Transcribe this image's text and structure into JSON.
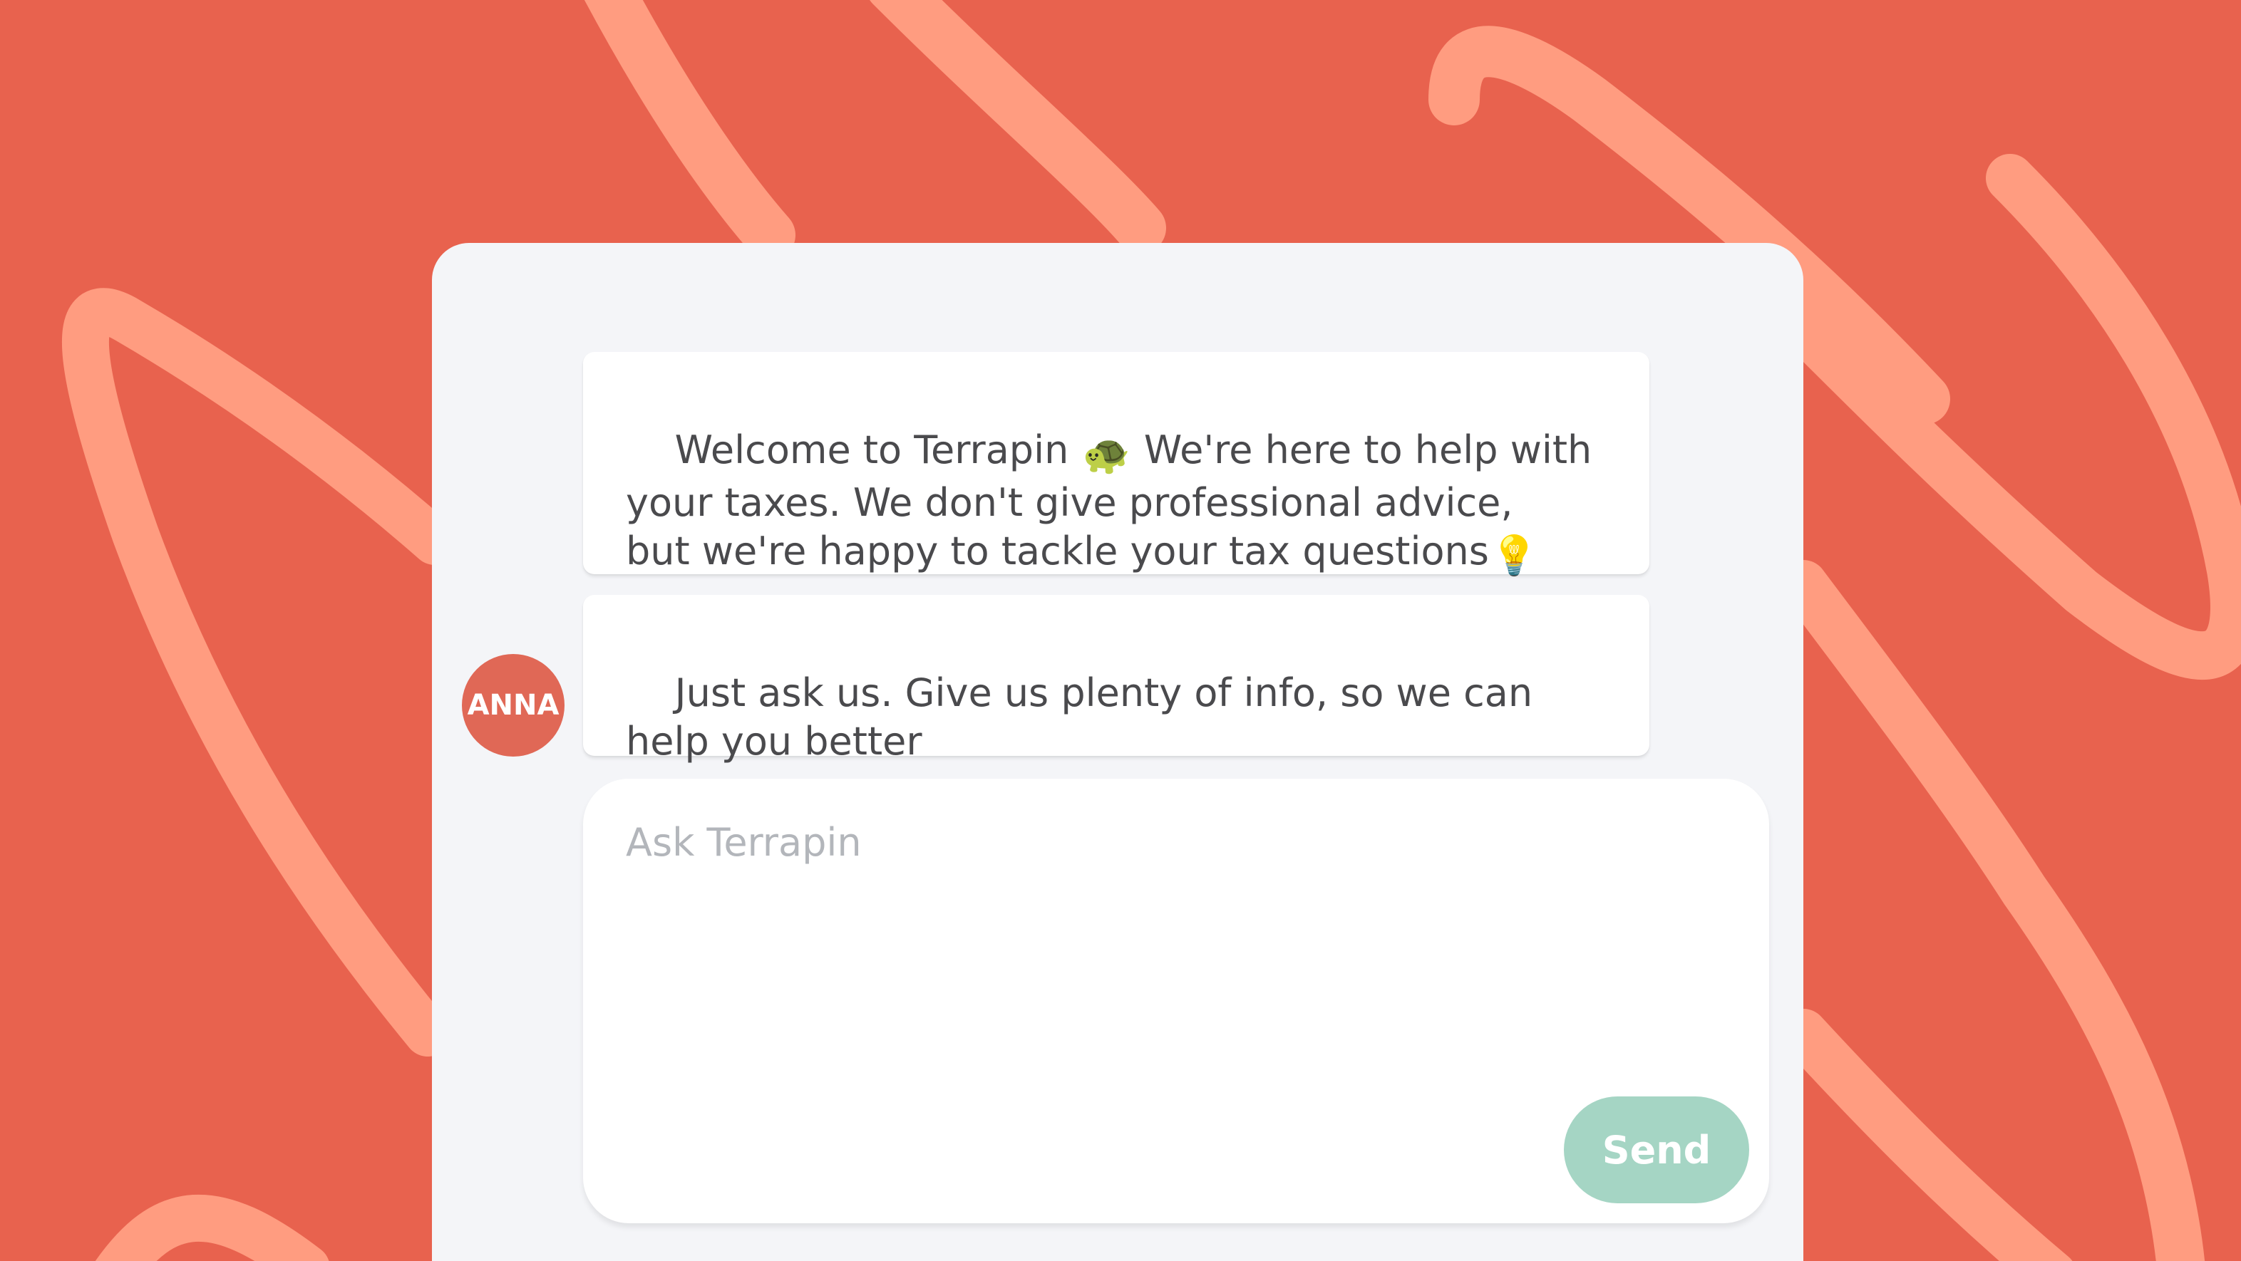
{
  "chat": {
    "messages": [
      {
        "line1_a": "Welcome to Terrapin ",
        "line1_emoji": "🐢",
        "line1_b": " We're here to help with",
        "line2": "your taxes. We don't give professional advice,",
        "line3_a": "but we're happy to tackle your tax questions",
        "line3_emoji": "💡"
      },
      {
        "line1": "Just ask us. Give us plenty of info, so we can",
        "line2": "help you better"
      }
    ],
    "avatar_text": "ANNA",
    "composer": {
      "placeholder": "Ask Terrapin",
      "send_label": "Send"
    }
  },
  "theme": {
    "background": "#e8624e",
    "stroke": "#ff9c80",
    "panel": "#f4f5f8",
    "send_button": "#a5d5c4",
    "avatar": "#e06856"
  }
}
